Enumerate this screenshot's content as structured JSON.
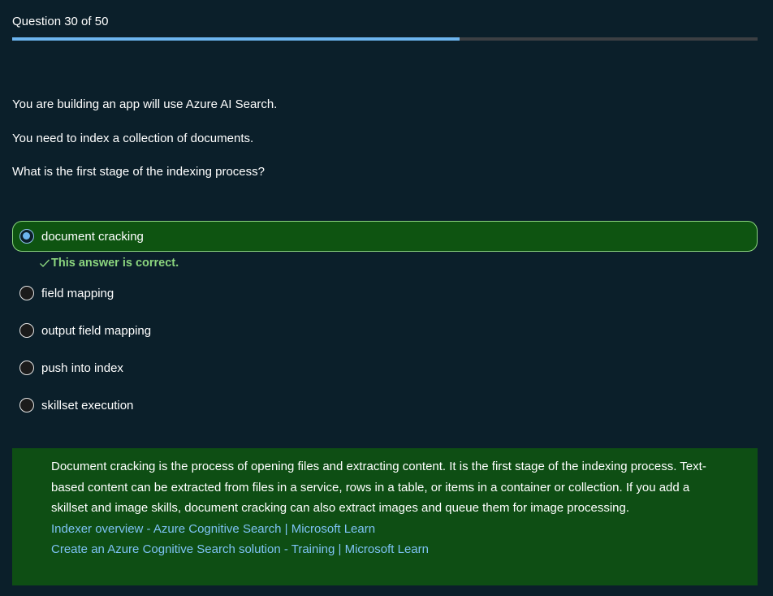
{
  "progress": {
    "label": "Question 30 of 50",
    "current": 30,
    "total": 50
  },
  "colors": {
    "background": "#0b1f2a",
    "accent": "#6cb4ee",
    "correct_bg": "#0e5411",
    "correct_text": "#8bd57e",
    "explanation_bg": "#0e4e14",
    "link": "#7ec3f5"
  },
  "question": {
    "lines": [
      "You are building an app will use Azure AI Search.",
      "You need to index a collection of documents.",
      "What is the first stage of the indexing process?"
    ]
  },
  "options": [
    {
      "label": "document cracking",
      "selected": true
    },
    {
      "label": "field mapping",
      "selected": false
    },
    {
      "label": "output field mapping",
      "selected": false
    },
    {
      "label": "push into index",
      "selected": false
    },
    {
      "label": "skillset execution",
      "selected": false
    }
  ],
  "feedback": {
    "icon": "check-icon",
    "text": "This answer is correct."
  },
  "explanation": {
    "text": "Document cracking is the process of opening files and extracting content. It is the first stage of the indexing process. Text-based content can be extracted from files in a service, rows in a table, or items in a container or collection. If you add a skillset and image skills, document cracking can also extract images and queue them for image processing.",
    "links": [
      "Indexer overview - Azure Cognitive Search | Microsoft Learn",
      "Create an Azure Cognitive Search solution - Training | Microsoft Learn"
    ]
  }
}
